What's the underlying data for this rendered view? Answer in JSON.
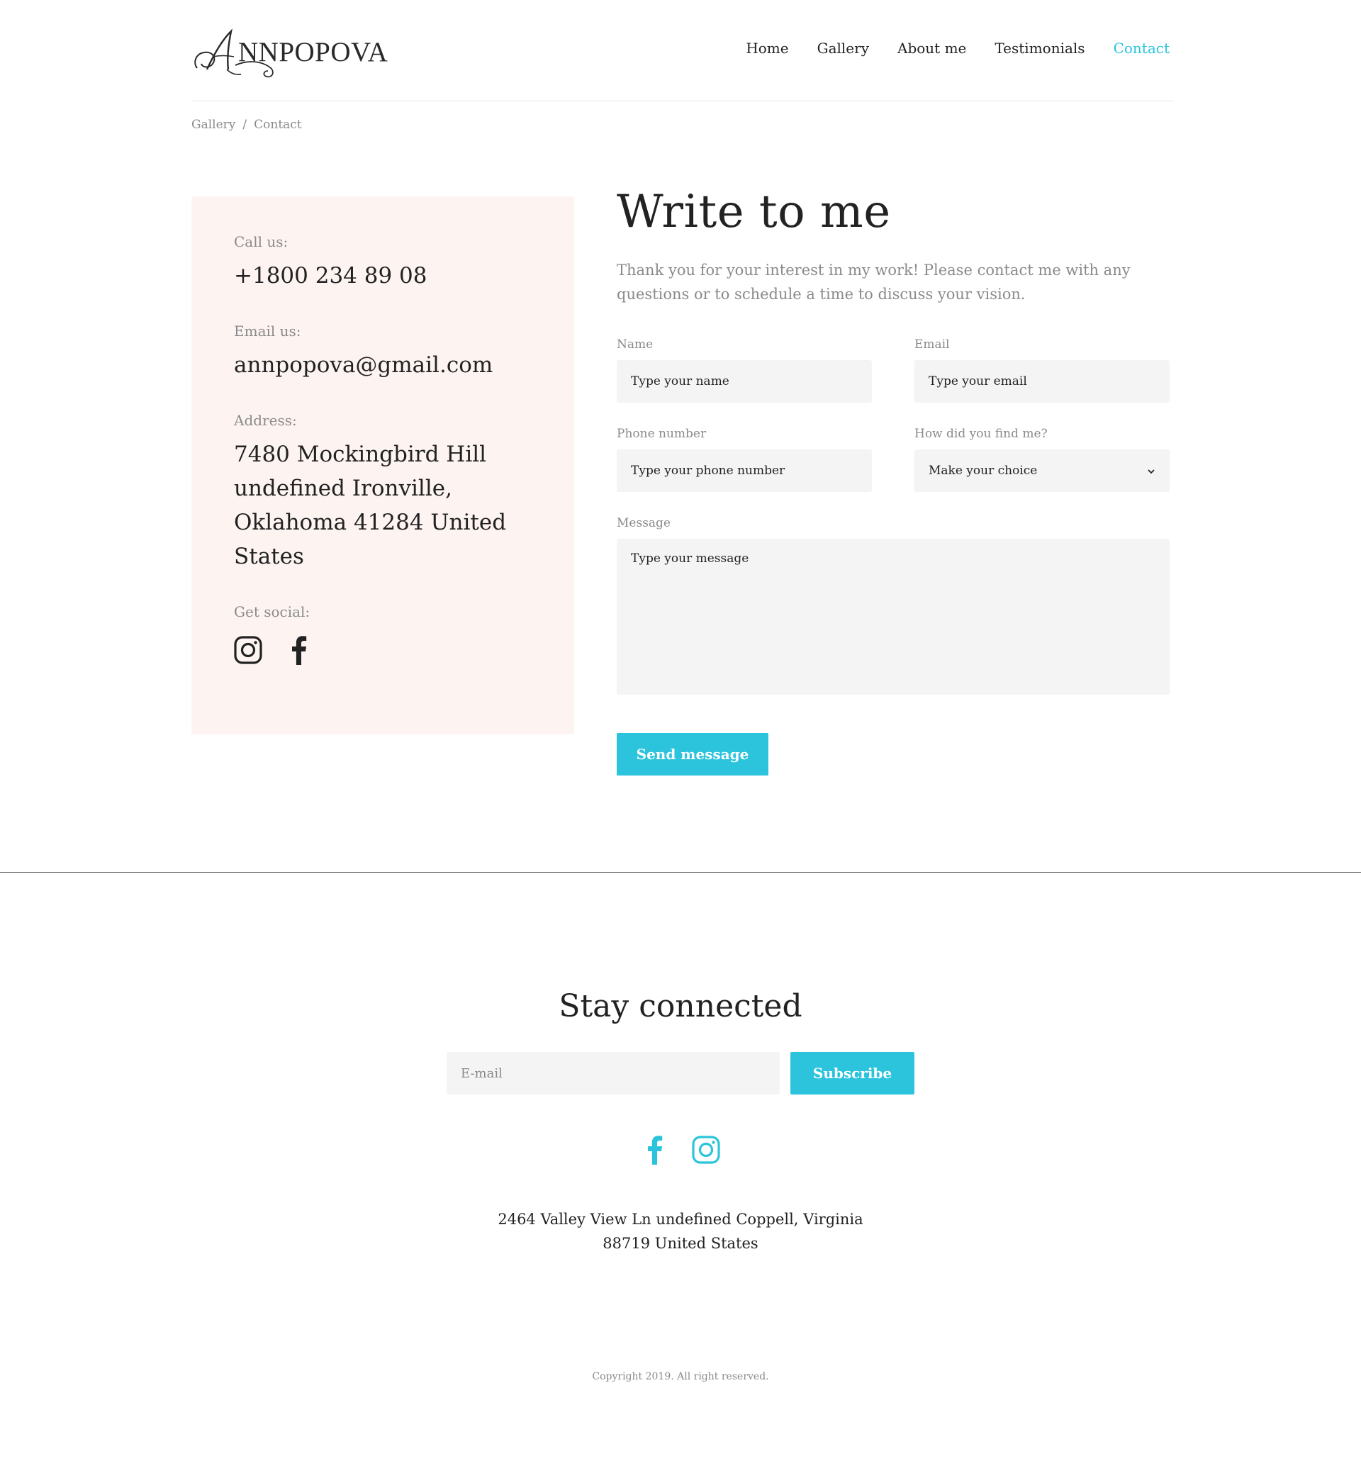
{
  "brand": {
    "logo_text": "NNPOPOVA",
    "accent_color": "#2bc4dc",
    "card_color": "#fdf4f2"
  },
  "nav": {
    "items": [
      "Home",
      "Gallery",
      "About me",
      "Testimonials",
      "Contact"
    ],
    "active": "Contact"
  },
  "breadcrumb": {
    "items": [
      "Gallery",
      "Contact"
    ],
    "separator": "/"
  },
  "contact_card": {
    "call_label": "Call us:",
    "call_value": "+1800 234 89 08",
    "email_label": "Email us:",
    "email_value": "annpopova@gmail.com",
    "address_label": "Address:",
    "address_value": "7480 Mockingbird Hill undefined Ironville, Oklahoma 41284 United States",
    "social_label": "Get social:",
    "social_icons": [
      "instagram-icon",
      "facebook-icon"
    ]
  },
  "form": {
    "title": "Write to me",
    "intro": "Thank you for your interest in my work! Please contact me with any questions or to schedule a time to discuss your vision.",
    "name_label": "Name",
    "name_placeholder": "Type your name",
    "email_label": "Email",
    "email_placeholder": "Type your email",
    "phone_label": "Phone number",
    "phone_placeholder": "Type your phone number",
    "source_label": "How did you find me?",
    "source_value": "Make your choice",
    "message_label": "Message",
    "message_placeholder": "Type your message",
    "send_label": "Send message"
  },
  "footer": {
    "stay_title": "Stay connected",
    "email_placeholder": "E-mail",
    "subscribe_label": "Subscribe",
    "social_icons": [
      "facebook-icon",
      "instagram-icon"
    ],
    "address_line1": "2464 Valley View Ln undefined Coppell, Virginia",
    "address_line2": "88719 United States",
    "copyright": "Copyright 2019. All right reserved."
  }
}
